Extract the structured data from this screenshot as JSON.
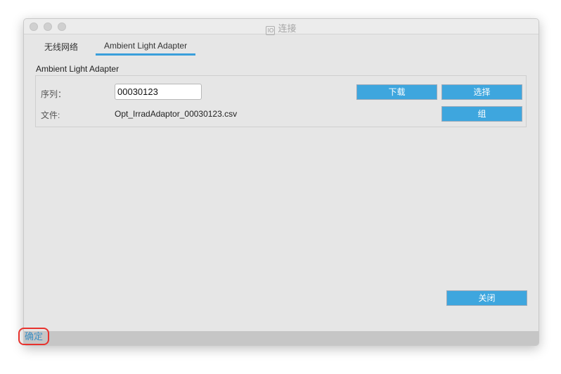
{
  "window": {
    "title": "连接",
    "title_icon": "app-icon"
  },
  "tabs": [
    {
      "label": "无线网络",
      "active": false
    },
    {
      "label": "Ambient Light Adapter",
      "active": true
    }
  ],
  "group": {
    "title": "Ambient Light Adapter",
    "serial_label": "序列：",
    "serial_value": "00030123",
    "file_label": "文件:",
    "file_value": "Opt_IrradAdaptor_00030123.csv",
    "download_button": "下载",
    "select_button": "选择",
    "group_button": "组"
  },
  "close_button": "关闭",
  "ok_button": "确定",
  "colors": {
    "accent": "#3ea6de",
    "highlight": "#e8322d"
  }
}
